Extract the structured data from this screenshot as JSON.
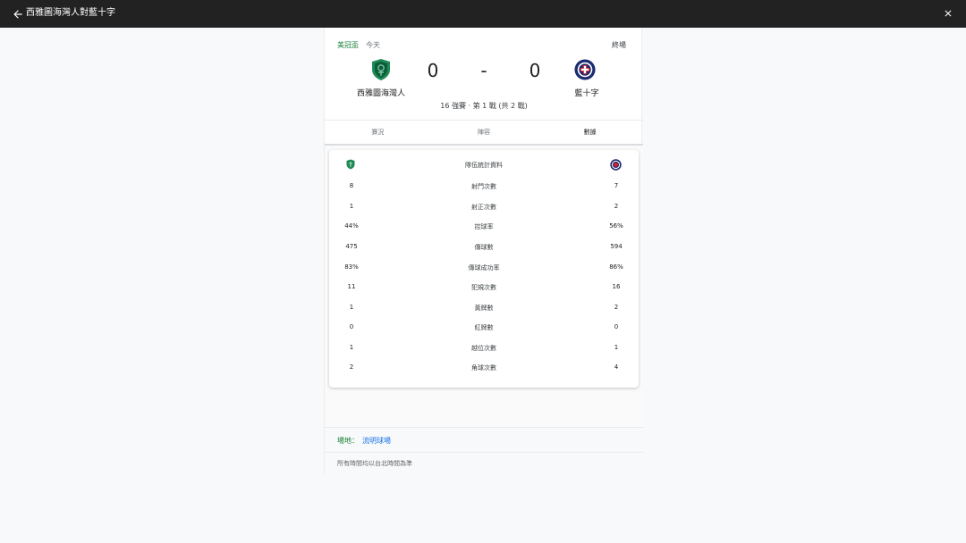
{
  "topbar": {
    "title": "西雅圖海灣人對藍十字",
    "back_icon": "arrow-left-icon",
    "close_icon": "close-icon"
  },
  "match": {
    "league": "美冠盃",
    "date": "今天",
    "status": "終場",
    "home": {
      "name": "西雅圖海灣人",
      "score": "0",
      "color": "#1e8a55"
    },
    "away": {
      "name": "藍十字",
      "score": "0",
      "color": "#1c2a6e"
    },
    "score_separator": "-",
    "round": "16 強賽 · 第 1 戰 (共 2 戰)"
  },
  "tabs": [
    {
      "label": "賽況",
      "active": false
    },
    {
      "label": "陣容",
      "active": false
    },
    {
      "label": "數據",
      "active": true
    }
  ],
  "stats": {
    "title": "隊伍統計資料",
    "rows": [
      {
        "label": "射門次數",
        "home": "8",
        "away": "7"
      },
      {
        "label": "射正次數",
        "home": "1",
        "away": "2"
      },
      {
        "label": "控球率",
        "home": "44%",
        "away": "56%"
      },
      {
        "label": "傳球數",
        "home": "475",
        "away": "594"
      },
      {
        "label": "傳球成功率",
        "home": "83%",
        "away": "86%"
      },
      {
        "label": "犯規次數",
        "home": "11",
        "away": "16"
      },
      {
        "label": "黃牌數",
        "home": "1",
        "away": "2"
      },
      {
        "label": "紅牌數",
        "home": "0",
        "away": "0"
      },
      {
        "label": "越位次數",
        "home": "1",
        "away": "1"
      },
      {
        "label": "角球次數",
        "home": "2",
        "away": "4"
      }
    ]
  },
  "venue": {
    "label": "場地：",
    "name": "流明球場"
  },
  "timezone_note": "所有時間均以台北時間為準"
}
